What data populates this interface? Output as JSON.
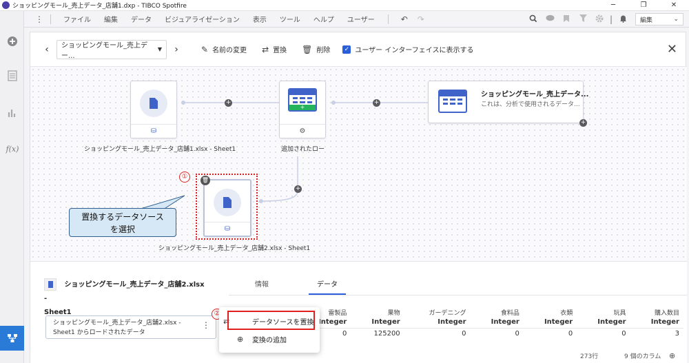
{
  "window": {
    "title": "ショッピングモール_売上データ_店舗1.dxp - TIBCO Spotfire",
    "minimize": "─",
    "restore": "❐",
    "close": "✕"
  },
  "menu": {
    "items": [
      "ファイル",
      "編集",
      "データ",
      "ビジュアライゼーション",
      "表示",
      "ツール",
      "ヘルプ",
      "ユーザー"
    ],
    "mode_select": "編集"
  },
  "toolbar": {
    "datasource": "ショッピングモール_売上デー...",
    "rename": "名前の変更",
    "replace": "置換",
    "delete": "削除",
    "show_in_ui": "ユーザー インターフェイスに表示する"
  },
  "flow": {
    "node1_label": "ショッピングモール_売上データ_店舗1.xlsx - Sheet1",
    "node2_label": "追加されたロー",
    "final_title": "ショッピングモール_売上データ...",
    "final_sub": "これは、分析で使用されるデータ...",
    "node3_label": "ショッピングモール_売上データ_店舗2.xlsx - Sheet1",
    "step1": "①",
    "step2": "②",
    "callout_line1": "置換するデータソース",
    "callout_line2": "を選択"
  },
  "bottom": {
    "source_title_line1": "ショッピングモール_売上データ_店舗2.xlsx -",
    "source_title_line2": "Sheet1",
    "step_line1": "ショッピングモール_売上データ_店舗2.xlsx -",
    "step_line2": "Sheet1 からロードされたデータ",
    "tabs": [
      "情報",
      "データ"
    ],
    "columns": [
      "雷製品",
      "果物",
      "ガーデニング",
      "食料品",
      "衣類",
      "玩具",
      "購入数目"
    ],
    "types": [
      "Integer",
      "Integer",
      "Integer",
      "Integer",
      "Integer",
      "Integer",
      "Integer"
    ],
    "row": [
      "0",
      "125200",
      "0",
      "0",
      "0",
      "0",
      "3"
    ],
    "row_count": "273行",
    "col_count": "9 個のカラム"
  },
  "popup": {
    "replace_source": "データソースを置換",
    "add_transform": "変換の追加"
  }
}
